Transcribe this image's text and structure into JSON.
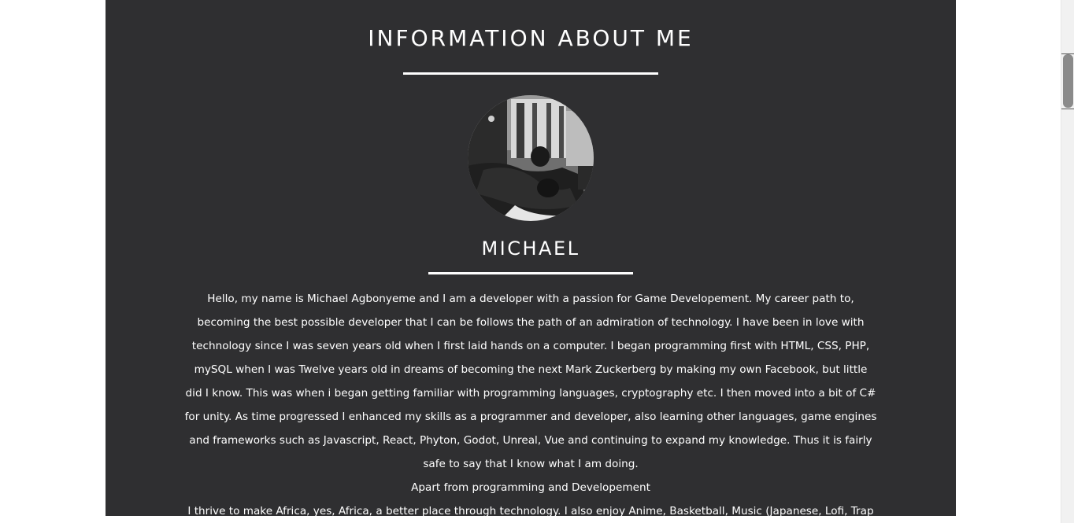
{
  "about": {
    "title": "INFORMATION ABOUT ME",
    "name": "MICHAEL",
    "avatar_icon": "profile-photo",
    "bio_paragraph": "Hello, my name is Michael Agbonyeme and I am a developer with a passion for Game Developement. My career path to, becoming the best possible developer that I can be follows the path of an admiration of technology. I have been in love with technology since I was seven years old when I first laid hands on a computer. I began programming first with HTML, CSS, PHP, mySQL when I was Twelve years old in dreams of becoming the next Mark Zuckerberg by making my own Facebook, but little did I know. This was when i began getting familiar with programming languages, cryptography etc. I then moved into a bit of C# for unity. As time progressed I enhanced my skills as a programmer and developer, also learning other languages, game engines and frameworks such as Javascript, React, Phyton, Godot, Unreal, Vue and continuing to expand my knowledge. Thus it is fairly safe to say that I know what I am doing.",
    "bio_line2": "Apart from programming and Developement",
    "bio_line3": "I thrive to make Africa, yes, Africa, a better place through technology. I also enjoy Anime, Basketball, Music (Japanese, Lofi, Trap etc.)"
  },
  "colors": {
    "panel_bg": "#2f2f31",
    "text": "#ffffff",
    "page_bg": "#ffffff"
  }
}
